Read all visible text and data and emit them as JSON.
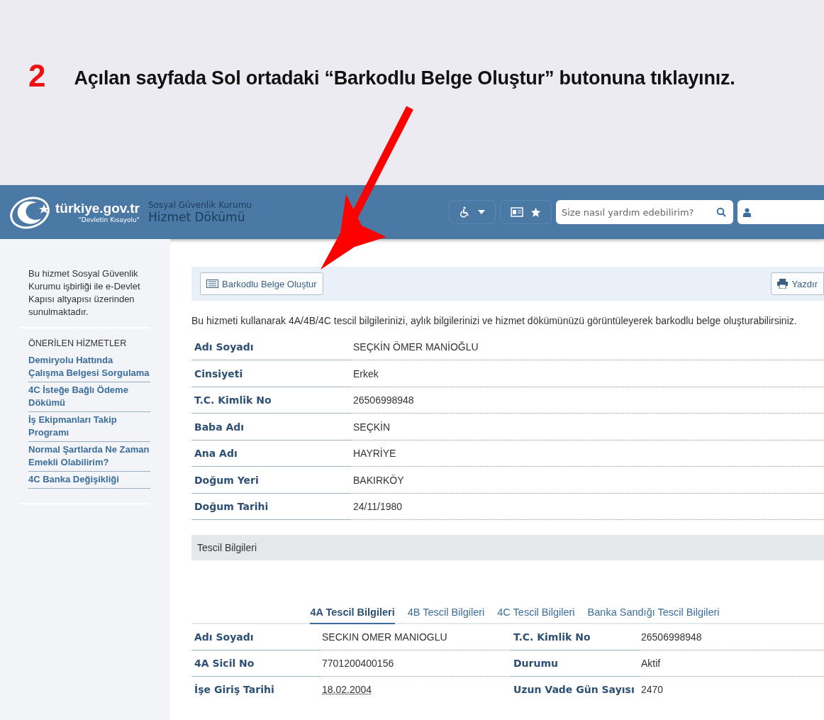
{
  "instruction": {
    "step": "2",
    "text": "Açılan sayfada Sol ortadaki “Barkodlu Belge Oluştur” butonuna tıklayınız."
  },
  "header": {
    "logo": "türkiye.gov.tr",
    "logo_slogan": "\"Devletin Kısayolu\"",
    "institution": "Sosyal Güvenlik Kurumu",
    "service": "Hizmet Dökümü",
    "search": {
      "placeholder": "Size nasıl yardım edebilirim?"
    }
  },
  "sidebar": {
    "about": "Bu hizmet Sosyal Güvenlik Kurumu işbirliği ile e-Devlet Kapısı altyapısı üzerinden sunulmaktadır.",
    "heading": "ÖNERİLEN HİZMETLER",
    "items": [
      "Demiryolu Hattında Çalışma Belgesi Sorgulama",
      "4C İsteğe Bağlı Ödeme Dökümü",
      "İş Ekipmanları Takip Programı",
      "Normal Şartlarda Ne Zaman Emekli Olabilirim?",
      "4C Banka Değişikliği"
    ]
  },
  "toolbar": {
    "barcode_button": "Barkodlu Belge Oluştur",
    "print_button": "Yazdır"
  },
  "intro": "Bu hizmeti kullanarak 4A/4B/4C tescil bilgilerinizi, aylık bilgilerinizi ve hizmet dökümünüzü görüntüleyerek barkodlu belge oluşturabilirsiniz.",
  "person": [
    {
      "label": "Adı Soyadı",
      "value": "SEÇKİN ÖMER MANİOĞLU"
    },
    {
      "label": "Cinsiyeti",
      "value": "Erkek"
    },
    {
      "label": "T.C. Kimlik No",
      "value": "26506998948"
    },
    {
      "label": "Baba Adı",
      "value": "SEÇKİN"
    },
    {
      "label": "Ana Adı",
      "value": "HAYRİYE"
    },
    {
      "label": "Doğum Yeri",
      "value": "BAKIRKÖY"
    },
    {
      "label": "Doğum Tarihi",
      "value": "24/11/1980"
    }
  ],
  "section_title": "Tescil Bilgileri",
  "tabs": [
    {
      "label": "4A Tescil Bilgileri",
      "selected": true
    },
    {
      "label": "4B Tescil Bilgileri",
      "selected": false
    },
    {
      "label": "4C Tescil Bilgileri",
      "selected": false
    },
    {
      "label": "Banka Sandığı Tescil Bilgileri",
      "selected": false
    }
  ],
  "registry": [
    [
      {
        "label": "Adı Soyadı",
        "value": "SECKIN OMER MANIOGLU"
      },
      {
        "label": "T.C. Kimlik No",
        "value": "26506998948"
      }
    ],
    [
      {
        "label": "4A Sicil No",
        "value": "7701200400156"
      },
      {
        "label": "Durumu",
        "value": "Aktif"
      }
    ],
    [
      {
        "label": "İşe Giriş Tarihi",
        "value": "18.02.2004"
      },
      {
        "label": "Uzun Vade Gün Sayısı",
        "value": "2470"
      }
    ]
  ]
}
